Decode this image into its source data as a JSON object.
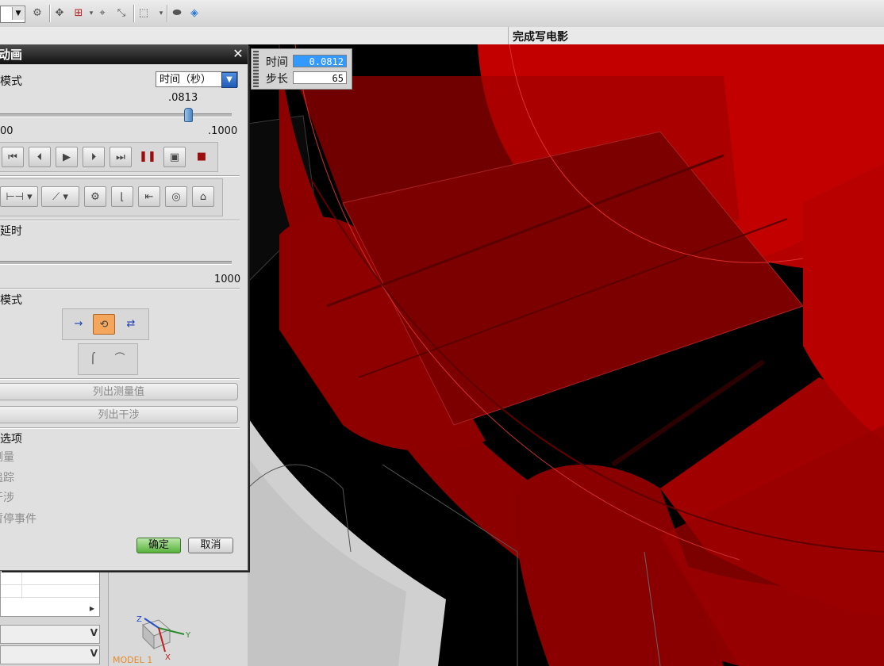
{
  "toolbar": {
    "icons": [
      "dropdown-arrow",
      "link-icon",
      "selection-filter-icon",
      "snap-point-icon",
      "measure-icon",
      "box-select-icon",
      "shaded-display-icon",
      "cube-icon"
    ]
  },
  "status": {
    "message": "完成写电影"
  },
  "time_step": {
    "time_label": "时间",
    "time_value": "0.0812",
    "step_label": "步长",
    "step_value": "65"
  },
  "dialog": {
    "title": "动画",
    "mode_label": "模式",
    "mode_value": "时间（秒）",
    "slider_value": ".0813",
    "slider_progress": 0.81,
    "range_min": "00",
    "range_max": ".1000",
    "delay_label": "延时",
    "delay_max": "1000",
    "playback_mode_label": "模式",
    "list_measurements": "列出测量值",
    "list_interference": "列出干涉",
    "options_label": "选项",
    "option_items": [
      "测量",
      "追踪",
      "干涉",
      "暂停事件"
    ],
    "ok": "确定",
    "cancel": "取消"
  },
  "model_label": "MODEL 1",
  "axis_labels": {
    "z": "Z",
    "y": "Y",
    "x": "X"
  },
  "colors": {
    "model_red": "#b00000",
    "viewport_bg": "#000000",
    "ok_green": "#58b23b"
  }
}
